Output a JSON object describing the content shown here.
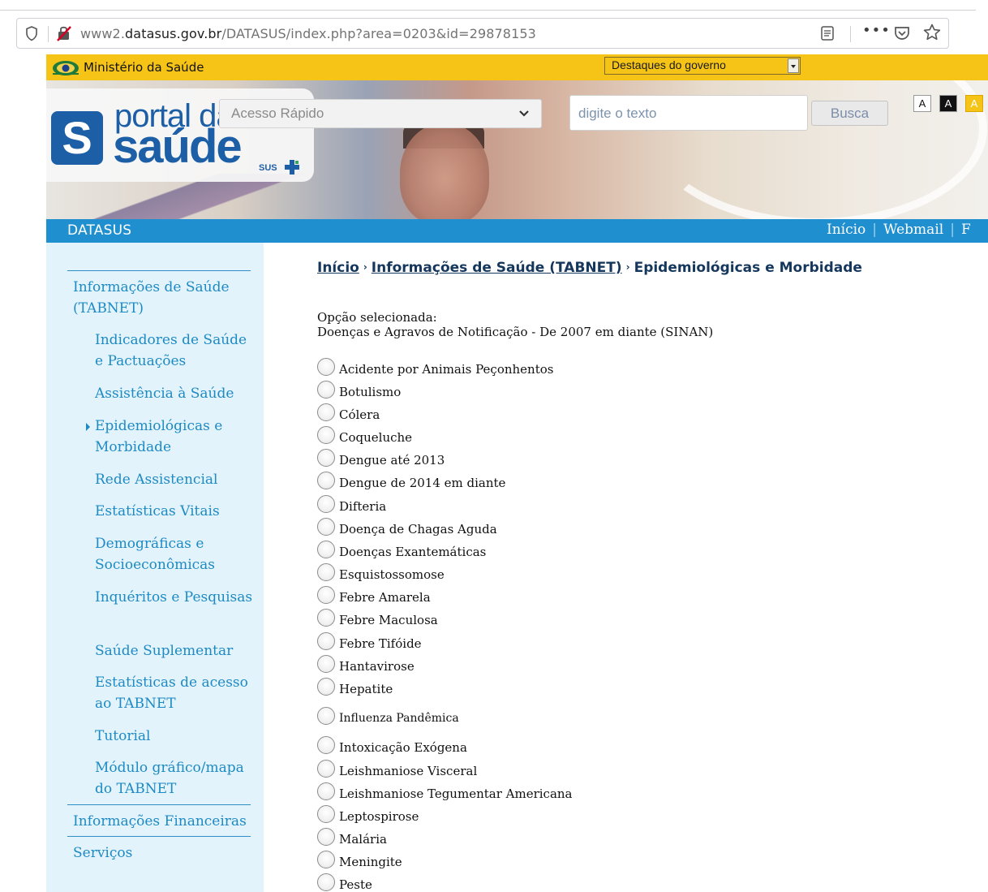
{
  "browser": {
    "url_prefix": "www2.",
    "url_host": "datasus.gov.br",
    "url_path": "/DATASUS/index.php?area=0203&id=29878153"
  },
  "gov_bar": {
    "title": "Ministério da Saúde",
    "dropdown_selected": "Destaques do governo"
  },
  "header": {
    "logo_line1": "portal da",
    "logo_line2": "saúde",
    "logo_s": "S",
    "logo_sus": "SUS",
    "quick_access_selected": "Acesso Rápido",
    "search_placeholder": "digite o texto",
    "search_button": "Busca",
    "font_buttons": [
      "A",
      "A",
      "A"
    ]
  },
  "navbar": {
    "brand": "DATASUS",
    "links": [
      "Início",
      "Webmail",
      "F"
    ]
  },
  "sidebar": {
    "section_selected": "Informações de Saúde (TABNET)",
    "sub_items": [
      "Indicadores de Saúde e Pactuações",
      "Assistência à Saúde",
      "Epidemiológicas e Morbidade",
      "Rede Assistencial",
      "Estatísticas Vitais",
      "Demográficas e Socioeconômicas",
      "Inquéritos e Pesquisas",
      "Saúde Suplementar",
      "Estatísticas de acesso ao TABNET",
      "Tutorial",
      "Módulo gráfico/mapa do TABNET"
    ],
    "section_financial": "Informações Financeiras",
    "section_services": "Serviços"
  },
  "breadcrumb": {
    "home": "Início",
    "tabnet": "Informações de Saúde (TABNET)",
    "current": "Epidemiológicas e Morbidade",
    "separator": "›"
  },
  "selection": {
    "label": "Opção selecionada:",
    "value": "Doenças e Agravos de Notificação - De 2007 em diante (SINAN)"
  },
  "options": [
    "Acidente por Animais Peçonhentos",
    "Botulismo",
    "Cólera",
    "Coqueluche",
    "Dengue até 2013",
    "Dengue de 2014 em diante",
    "Difteria",
    "Doença de Chagas Aguda",
    "Doenças Exantemáticas",
    "Esquistossomose",
    "Febre Amarela",
    "Febre Maculosa",
    "Febre Tifóide",
    "Hantavirose",
    "Hepatite",
    "Influenza Pandêmica",
    "Intoxicação Exógena",
    "Leishmaniose Visceral",
    "Leishmaniose Tegumentar Americana",
    "Leptospirose",
    "Malária",
    "Meningite",
    "Peste"
  ],
  "colors": {
    "gov_yellow": "#f5c417",
    "nav_blue": "#1f8fcf",
    "sidebar_bg": "#e2f3fb",
    "link_blue": "#1e8ac4",
    "logo_blue": "#1d5fa6"
  }
}
